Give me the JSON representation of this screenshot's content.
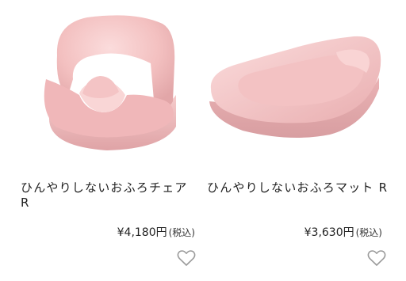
{
  "products": [
    {
      "name": "ひんやりしないおふろチェア R",
      "price": "¥4,180円",
      "tax_label": "(税込)",
      "image_icon": "baby-bath-chair-image",
      "favorite_icon": "heart-outline-icon",
      "product_color": "#f2bcbc"
    },
    {
      "name": "ひんやりしないおふろマット R",
      "price": "¥3,630円",
      "tax_label": "(税込)",
      "image_icon": "baby-bath-mat-image",
      "favorite_icon": "heart-outline-icon",
      "product_color": "#f2bcbc"
    }
  ]
}
